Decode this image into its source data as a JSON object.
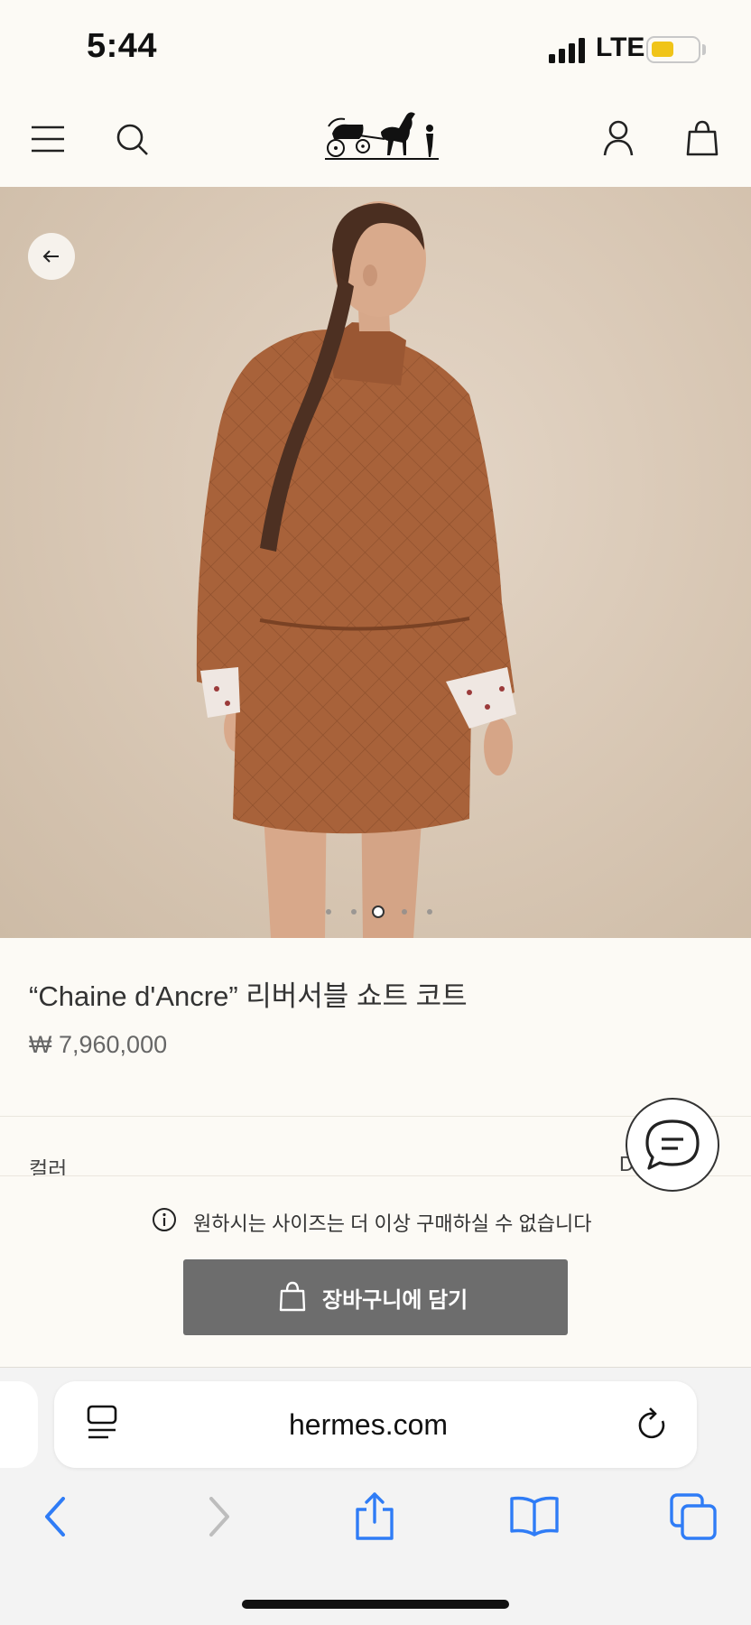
{
  "status_bar": {
    "time": "5:44",
    "network": "LTE"
  },
  "header": {
    "icons": [
      "menu-icon",
      "search-icon",
      "logo-icon",
      "account-icon",
      "shopping-bag-icon"
    ]
  },
  "hero": {
    "carousel_total": 5,
    "carousel_active": 3
  },
  "product": {
    "title": "“Chaine d'Ancre” 리버서블 쇼트 코트",
    "price": "₩ 7,960,000",
    "color_label": "컬러",
    "color_value": "D"
  },
  "sticky": {
    "message": "원하시는 사이즈는 더 이상 구매하실 수 없습니다",
    "cart_button_label": "장바구니에 담기"
  },
  "browser": {
    "url": "hermes.com",
    "toolbar": [
      "back-icon",
      "forward-icon",
      "share-icon",
      "bookmarks-icon",
      "tabs-icon"
    ]
  },
  "colors": {
    "background": "#fcfaf5",
    "button": "#6d6d6d",
    "coat": "#a8623a",
    "ios_blue": "#2f7cf6"
  }
}
